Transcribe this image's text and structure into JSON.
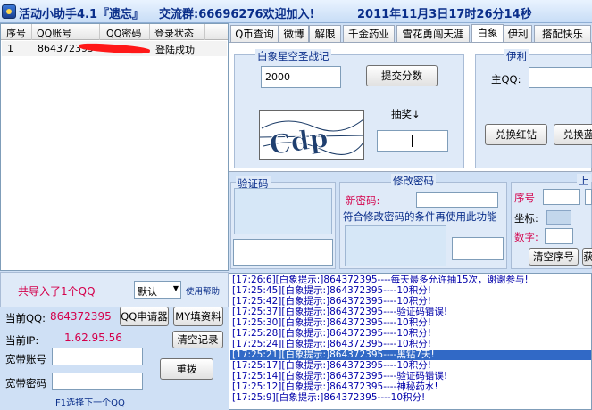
{
  "title": {
    "app": "活动小助手4.1『遗忘』",
    "group": "交流群:66696276欢迎加入!",
    "datetime": "2011年11月3日17时26分14秒"
  },
  "qq_table": {
    "columns": [
      "序号",
      "QQ账号",
      "QQ密码",
      "登录状态"
    ],
    "rows": [
      {
        "index": "1",
        "account": "864372395",
        "status": "登陆成功"
      }
    ]
  },
  "tabs": [
    "Q币查询",
    "微博",
    "解限",
    "千金药业",
    "雪花勇闯天涯",
    "白象",
    "伊利",
    "搭配快乐"
  ],
  "active_tab": "白象",
  "baixiang": {
    "group_title": "白象星空圣战记",
    "score_value": "2000",
    "submit_button": "提交分数",
    "lottery_label": "抽奖↓",
    "captcha_text": "Cdp"
  },
  "yili": {
    "group_title": "伊利",
    "main_qq_label": "主QQ:",
    "redeem_red_button": "兑换红钻",
    "redeem_blue_button": "兑换蓝"
  },
  "verify": {
    "group_title": "验证码"
  },
  "change_password": {
    "group_title": "修改密码",
    "new_password_label": "新密码:",
    "hint": "符合修改密码的条件再使用此功能"
  },
  "coords_panel": {
    "group_title": "上",
    "index_label": "序号",
    "coord_label": "坐标:",
    "number_label": "数字:",
    "clear_index_button": "清空序号",
    "cut_button": "获"
  },
  "bottom_left": {
    "imported": "一共导入了1个QQ",
    "select_value": "默认",
    "help_link": "使用帮助",
    "current_qq_label": "当前QQ:",
    "current_qq_value": "864372395",
    "qq_apply_button": "QQ申请器",
    "my_fill_button": "MY填资料",
    "current_ip_label": "当前IP:",
    "current_ip_value": "1.62.95.56",
    "clear_log_button": "清空记录",
    "broadband_account_label": "宽带账号",
    "broadband_password_label": "宽带密码",
    "redial_button": "重拨",
    "f1_hint": "F1选择下一个QQ"
  },
  "log": [
    "[17:26:6][白象提示:]864372395----每天最多允许抽15次，谢谢参与!",
    "[17:25:45][白象提示:]864372395----10积分!",
    "[17:25:42][白象提示:]864372395----10积分!",
    "[17:25:37][白象提示:]864372395----验证码错误!",
    "[17:25:30][白象提示:]864372395----10积分!",
    "[17:25:28][白象提示:]864372395----10积分!",
    "[17:25:24][白象提示:]864372395----10积分!",
    "[17:25:21][白象提示:]864372395----黑钻7天!",
    "[17:25:17][白象提示:]864372395----10积分!",
    "[17:25:14][白象提示:]864372395----验证码错误!",
    "[17:25:12][白象提示:]864372395----神秘药水!",
    "[17:25:9][白象提示:]864372395----10积分!"
  ],
  "selected_log_index": 7,
  "colors": {
    "accent": "#0a2e8a",
    "highlight": "#d4004b",
    "selection": "#3169c6",
    "log_text": "#0000aa"
  }
}
